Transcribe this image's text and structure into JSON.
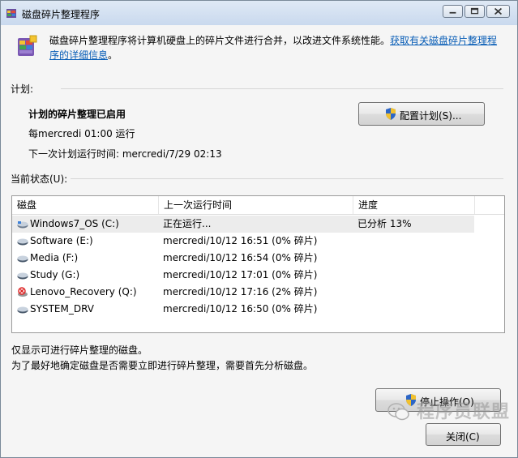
{
  "window": {
    "title": "磁盘碎片整理程序",
    "minimize_icon": "minimize-icon",
    "maximize_icon": "maximize-icon",
    "close_icon": "close-icon"
  },
  "header": {
    "icon": "defrag-app-icon",
    "description": "磁盘碎片整理程序将计算机硬盘上的碎片文件进行合并，以改进文件系统性能。",
    "link_text": "获取有关磁盘碎片整理程序的详细信息",
    "link_suffix": "。"
  },
  "schedule": {
    "label": "计划:",
    "title": "计划的碎片整理已启用",
    "frequency": "每mercredi  01:00 运行",
    "next_run": "下一次计划运行时间: mercredi/7/29 02:13",
    "configure_button": "配置计划(S)..."
  },
  "status": {
    "label": "当前状态(U):",
    "columns": [
      "磁盘",
      "上一次运行时间",
      "进度"
    ],
    "drives": [
      {
        "name": "Windows7_OS (C:)",
        "last_run": "正在运行...",
        "progress": "已分析 13%",
        "icon": "system-drive-icon",
        "selected": true
      },
      {
        "name": "Software (E:)",
        "last_run": "mercredi/10/12 16:51 (0% 碎片)",
        "progress": "",
        "icon": "drive-icon",
        "selected": false
      },
      {
        "name": "Media (F:)",
        "last_run": "mercredi/10/12 16:54 (0% 碎片)",
        "progress": "",
        "icon": "drive-icon",
        "selected": false
      },
      {
        "name": "Study (G:)",
        "last_run": "mercredi/10/12 17:01 (0% 碎片)",
        "progress": "",
        "icon": "drive-icon",
        "selected": false
      },
      {
        "name": "Lenovo_Recovery (Q:)",
        "last_run": "mercredi/10/12 17:16 (2% 碎片)",
        "progress": "",
        "icon": "recovery-drive-icon",
        "selected": false
      },
      {
        "name": "SYSTEM_DRV",
        "last_run": "mercredi/10/12 16:50 (0% 碎片)",
        "progress": "",
        "icon": "drive-icon",
        "selected": false
      }
    ]
  },
  "notes": {
    "line1": "仅显示可进行碎片整理的磁盘。",
    "line2": "为了最好地确定磁盘是否需要立即进行碎片整理，需要首先分析磁盘。"
  },
  "actions": {
    "stop_button": "停止操作(O)",
    "close_button": "关闭(C)"
  },
  "watermark": {
    "text": "程序员联盟",
    "icon": "wechat-icon"
  },
  "colors": {
    "link": "#0b5fb7",
    "selection": "#ececec",
    "titlebar": "#c9d9ee"
  }
}
